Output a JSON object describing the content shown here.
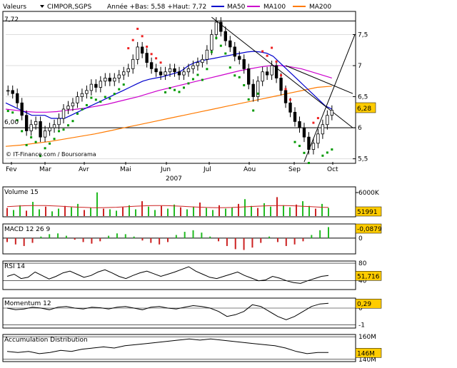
{
  "header": {
    "prefix": "Valeurs",
    "ticker": "CIMPOR,SGPS",
    "range_text": "Année +Bas: 5,58 +Haut: 7,72",
    "legend": [
      {
        "name": "MA50",
        "color": "#0000cc"
      },
      {
        "name": "MA100",
        "color": "#cc00cc"
      },
      {
        "name": "MA200",
        "color": "#ff7a00"
      }
    ]
  },
  "watermark": "© IT-Finance.com / Boursorama",
  "colors": {
    "up_candle": "#ffffff",
    "down_candle": "#000000",
    "sar_up": "#009900",
    "sar_down": "#ee2222",
    "ma50": "#0000cc",
    "ma100": "#cc00cc",
    "ma200": "#ff7a00",
    "volume_up": "#22bb22",
    "volume_down": "#cc2222",
    "volume_ma": "#cc2222",
    "value_box": "#ffcc00"
  },
  "chart_data": [
    {
      "type": "candlestick",
      "name": "price",
      "ylim": [
        5.45,
        7.85
      ],
      "yticks": [
        5.5,
        6,
        6.5,
        7,
        7.5
      ],
      "ytick_labels": [
        "5,5",
        "6",
        "6,5",
        "7",
        "7,5"
      ],
      "ref_lines": [
        {
          "value": 7.72,
          "label": "7,72"
        },
        {
          "value": 6.0,
          "label": "6,00"
        }
      ],
      "current_value": "6,28",
      "x_months": [
        "Fev",
        "Mar",
        "Avr",
        "Mai",
        "Jun",
        "Jul",
        "Aou",
        "Sep",
        "Oct"
      ],
      "year": "2007",
      "close": [
        6.6,
        6.55,
        6.4,
        6.2,
        5.95,
        6.05,
        6.1,
        5.85,
        5.95,
        6.0,
        6.05,
        6.15,
        6.3,
        6.35,
        6.4,
        6.5,
        6.55,
        6.6,
        6.7,
        6.65,
        6.75,
        6.8,
        6.75,
        6.8,
        6.85,
        6.9,
        6.95,
        7.1,
        7.3,
        7.2,
        7.05,
        6.95,
        6.9,
        6.85,
        6.9,
        6.95,
        6.9,
        6.85,
        6.9,
        6.95,
        7.0,
        7.05,
        7.1,
        7.25,
        7.5,
        7.7,
        7.55,
        7.4,
        7.3,
        7.15,
        7.1,
        6.95,
        6.7,
        6.5,
        6.75,
        6.9,
        6.85,
        7.0,
        6.8,
        6.6,
        6.4,
        6.25,
        6.1,
        6.0,
        5.85,
        5.65,
        5.75,
        5.9,
        6.05,
        6.2,
        6.28
      ],
      "sar_points": [
        {
          "i": 0,
          "v": 6.2,
          "side": "below"
        },
        {
          "i": 6,
          "v": 5.9,
          "side": "below"
        },
        {
          "i": 12,
          "v": 6.1,
          "side": "below"
        },
        {
          "i": 20,
          "v": 6.45,
          "side": "below"
        },
        {
          "i": 26,
          "v": 7.25,
          "side": "above"
        },
        {
          "i": 34,
          "v": 6.75,
          "side": "below"
        },
        {
          "i": 42,
          "v": 6.8,
          "side": "below"
        },
        {
          "i": 48,
          "v": 7.0,
          "side": "below"
        },
        {
          "i": 55,
          "v": 7.6,
          "side": "above"
        },
        {
          "i": 62,
          "v": 6.4,
          "side": "below"
        },
        {
          "i": 66,
          "v": 6.9,
          "side": "above"
        },
        {
          "i": 68,
          "v": 5.6,
          "side": "below"
        }
      ],
      "ma50": [
        6.4,
        6.35,
        6.3,
        6.25,
        6.2,
        6.2,
        6.2,
        6.15,
        6.15,
        6.15,
        6.2,
        6.25,
        6.3,
        6.35,
        6.4,
        6.45,
        6.5,
        6.55,
        6.6,
        6.65,
        6.7,
        6.75,
        6.78,
        6.8,
        6.82,
        6.85,
        6.88,
        6.92,
        7.0,
        7.05,
        7.08,
        7.1,
        7.12,
        7.14,
        7.16,
        7.18,
        7.2,
        7.22,
        7.23,
        7.22,
        7.2,
        7.15,
        7.05,
        6.95,
        6.85,
        6.75,
        6.65,
        6.55,
        6.45,
        6.35,
        6.3
      ],
      "ma100": [
        6.3,
        6.28,
        6.26,
        6.25,
        6.25,
        6.26,
        6.28,
        6.3,
        6.32,
        6.35,
        6.38,
        6.42,
        6.46,
        6.5,
        6.55,
        6.6,
        6.64,
        6.68,
        6.72,
        6.76,
        6.8,
        6.84,
        6.88,
        6.92,
        6.95,
        6.98,
        7.0,
        7.0,
        6.98,
        6.95,
        6.9,
        6.85,
        6.8
      ],
      "ma200": [
        5.7,
        5.72,
        5.75,
        5.78,
        5.82,
        5.86,
        5.9,
        5.95,
        6.0,
        6.05,
        6.1,
        6.15,
        6.2,
        6.25,
        6.3,
        6.35,
        6.4,
        6.45,
        6.5,
        6.55,
        6.6,
        6.65,
        6.67
      ]
    },
    {
      "type": "bar",
      "name": "Volume 15",
      "ylim": [
        0,
        7000000
      ],
      "ytick_labels": [
        "6000K"
      ],
      "current_value": "51991",
      "values": [
        1.2,
        0.9,
        1.6,
        0.8,
        2.1,
        1.0,
        1.4,
        0.7,
        1.1,
        1.5,
        1.3,
        1.8,
        0.9,
        1.2,
        3.5,
        1.1,
        1.0,
        0.8,
        1.3,
        1.6,
        1.0,
        2.2,
        1.4,
        0.9,
        1.5,
        1.1,
        1.7,
        1.3,
        1.0,
        1.4,
        2.0,
        1.2,
        0.9,
        1.6,
        1.1,
        1.3,
        1.8,
        2.5,
        1.5,
        1.2,
        1.9,
        1.4,
        2.8,
        1.6,
        1.3,
        1.7,
        2.2,
        1.5,
        1.1,
        1.8,
        1.2
      ]
    },
    {
      "type": "bar",
      "name": "MACD 12 26 9",
      "ylim": [
        -0.2,
        0.18
      ],
      "ytick_labels": [
        "0"
      ],
      "current_value": "-0,0879",
      "values": [
        -0.05,
        -0.08,
        -0.1,
        -0.06,
        0.02,
        0.05,
        0.06,
        0.03,
        -0.02,
        -0.05,
        -0.07,
        -0.04,
        0.03,
        0.06,
        0.05,
        0.02,
        -0.03,
        -0.06,
        -0.08,
        -0.05,
        0.04,
        0.08,
        0.1,
        0.07,
        0.02,
        -0.04,
        -0.1,
        -0.14,
        -0.15,
        -0.12,
        -0.06,
        0.02,
        -0.05,
        -0.1,
        -0.08,
        -0.04,
        0.04,
        0.1,
        0.14
      ]
    },
    {
      "type": "line",
      "name": "RSI 14",
      "ylim": [
        20,
        85
      ],
      "ytick_labels": [
        "80",
        "40"
      ],
      "current_value": "51,716",
      "values": [
        50,
        55,
        45,
        48,
        60,
        52,
        44,
        50,
        58,
        62,
        55,
        48,
        52,
        60,
        65,
        58,
        50,
        45,
        52,
        58,
        62,
        56,
        50,
        55,
        60,
        66,
        72,
        62,
        55,
        48,
        45,
        50,
        55,
        60,
        52,
        46,
        40,
        42,
        50,
        46,
        40,
        36,
        34,
        40,
        45,
        50,
        52
      ]
    },
    {
      "type": "line",
      "name": "Momentum 12",
      "ylim": [
        -1.2,
        0.6
      ],
      "ytick_labels": [
        "0",
        "-1"
      ],
      "current_value": "0,29",
      "values": [
        0.0,
        -0.1,
        -0.05,
        0.05,
        0.0,
        -0.1,
        0.05,
        0.1,
        0.0,
        -0.05,
        0.05,
        0.02,
        -0.05,
        0.05,
        0.1,
        0.0,
        -0.1,
        0.05,
        0.1,
        0.0,
        -0.05,
        0.05,
        0.15,
        0.1,
        0.0,
        -0.2,
        -0.5,
        -0.4,
        -0.2,
        0.2,
        0.1,
        -0.2,
        -0.5,
        -0.7,
        -0.5,
        -0.2,
        0.1,
        0.25,
        0.29
      ]
    },
    {
      "type": "line",
      "name": "Accumulation Distribution",
      "ylim": [
        138,
        162
      ],
      "ytick_labels": [
        "160M",
        "140M"
      ],
      "current_value": "146M",
      "values": [
        147,
        146,
        147,
        145,
        146,
        148,
        147,
        149,
        150,
        151,
        150,
        152,
        153,
        154,
        155,
        156,
        157,
        158,
        157,
        158,
        157,
        156,
        155,
        154,
        153,
        152,
        150,
        147,
        145,
        146,
        146
      ]
    }
  ]
}
